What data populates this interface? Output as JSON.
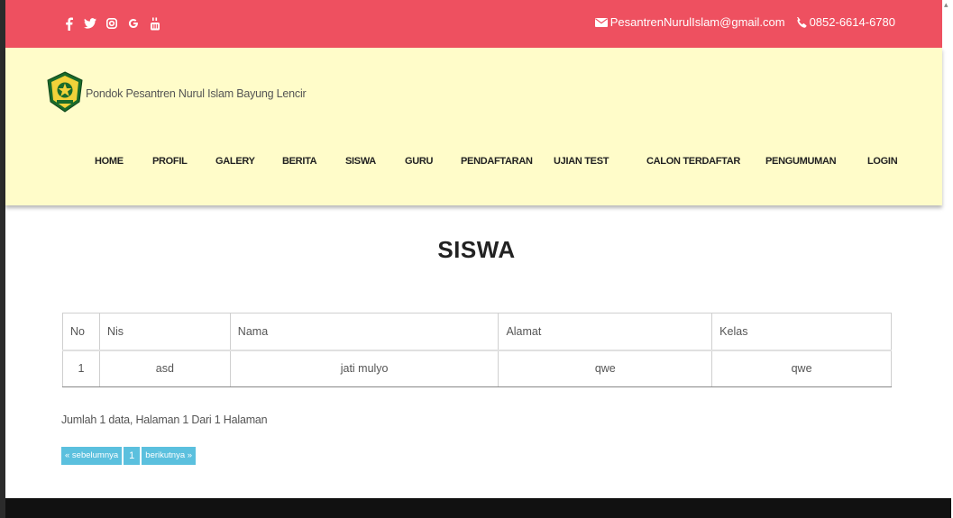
{
  "topbar": {
    "social": [
      {
        "icon": "facebook-icon",
        "glyph": "f"
      },
      {
        "icon": "twitter-icon",
        "glyph": "tw"
      },
      {
        "icon": "instagram-icon",
        "glyph": "ig"
      },
      {
        "icon": "google-icon",
        "glyph": "G"
      },
      {
        "icon": "youtube-icon",
        "glyph": "yt"
      }
    ],
    "email": "PesantrenNurulIslam@gmail.com",
    "phone": "0852-6614-6780",
    "background": "#ee5060"
  },
  "header": {
    "brand": "Pondok Pesantren Nurul Islam Bayung Lencir",
    "background": "#fffcc9",
    "nav": [
      "HOME",
      "PROFIL",
      "GALERY",
      "BERITA",
      "SISWA",
      "GURU",
      "PENDAFTARAN",
      "UJIAN TEST",
      "CALON TERDAFTAR",
      "PENGUMUMAN",
      "LOGIN"
    ]
  },
  "main": {
    "title": "SISWA",
    "table": {
      "columns": [
        "No",
        "Nis",
        "Nama",
        "Alamat",
        "Kelas"
      ],
      "rows": [
        [
          "1",
          "asd",
          "jati mulyo",
          "qwe",
          "qwe"
        ]
      ]
    },
    "summary": "Jumlah 1 data, Halaman 1 Dari 1 Halaman",
    "pager": {
      "prev": "« sebelumnya",
      "page": "1",
      "next": "berikutnya »",
      "color": "#5bc0de"
    }
  }
}
